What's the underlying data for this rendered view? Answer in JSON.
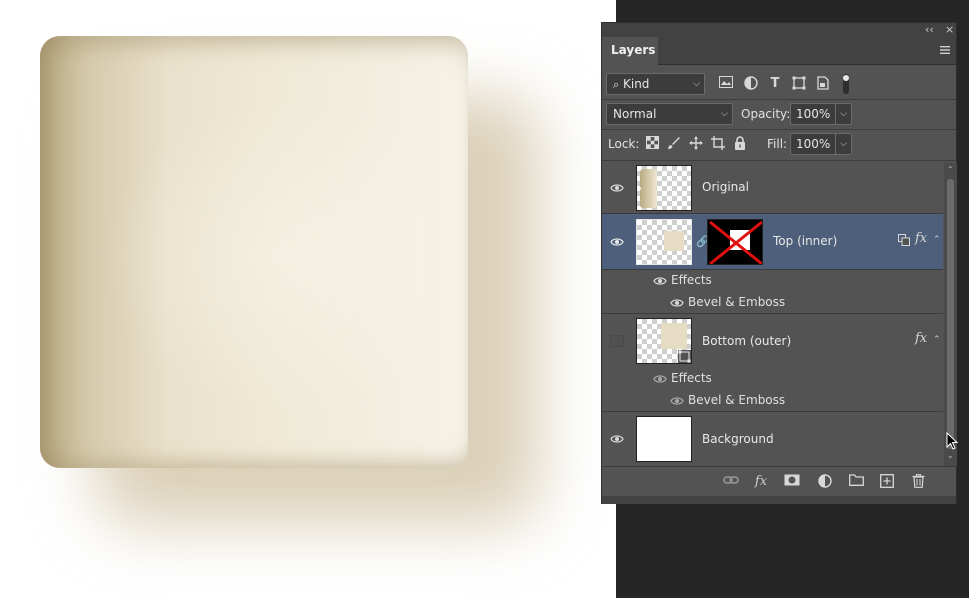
{
  "panel": {
    "tab_label": "Layers",
    "collapse_glyph": "‹‹",
    "close_glyph": "×",
    "filter_kind": "Kind",
    "blend_mode": "Normal",
    "opacity_label": "Opacity:",
    "opacity_value": "100%",
    "lock_label": "Lock:",
    "fill_label": "Fill:",
    "fill_value": "100%"
  },
  "layers": [
    {
      "name": "Original",
      "visible": true,
      "selected": false
    },
    {
      "name": "Top (inner)",
      "visible": true,
      "selected": true,
      "fx": "fx",
      "effects_label": "Effects",
      "effect": "Bevel & Emboss"
    },
    {
      "name": "Bottom (outer)",
      "visible": false,
      "selected": false,
      "fx": "fx",
      "effects_label": "Effects",
      "effect": "Bevel & Emboss"
    },
    {
      "name": "Background",
      "visible": true,
      "selected": false
    }
  ],
  "colors": {
    "panel_bg": "#535353",
    "selected_row": "#4d5f7a",
    "app_bg": "#262626",
    "tile_light": "#f3eedf",
    "tile_dark": "#b9aa82"
  },
  "icons": {
    "filter": [
      "image-filter-icon",
      "adjustment-filter-icon",
      "type-filter-icon",
      "shape-filter-icon",
      "smart-object-filter-icon",
      "filter-toggle-icon"
    ],
    "lock": [
      "lock-transparent-pixels-icon",
      "lock-image-pixels-icon",
      "lock-position-icon",
      "lock-artboard-icon",
      "lock-all-icon"
    ],
    "footer": [
      "link-layers-icon",
      "add-style-icon",
      "add-mask-icon",
      "adjustment-layer-icon",
      "new-group-icon",
      "new-layer-icon",
      "delete-layer-icon"
    ]
  }
}
